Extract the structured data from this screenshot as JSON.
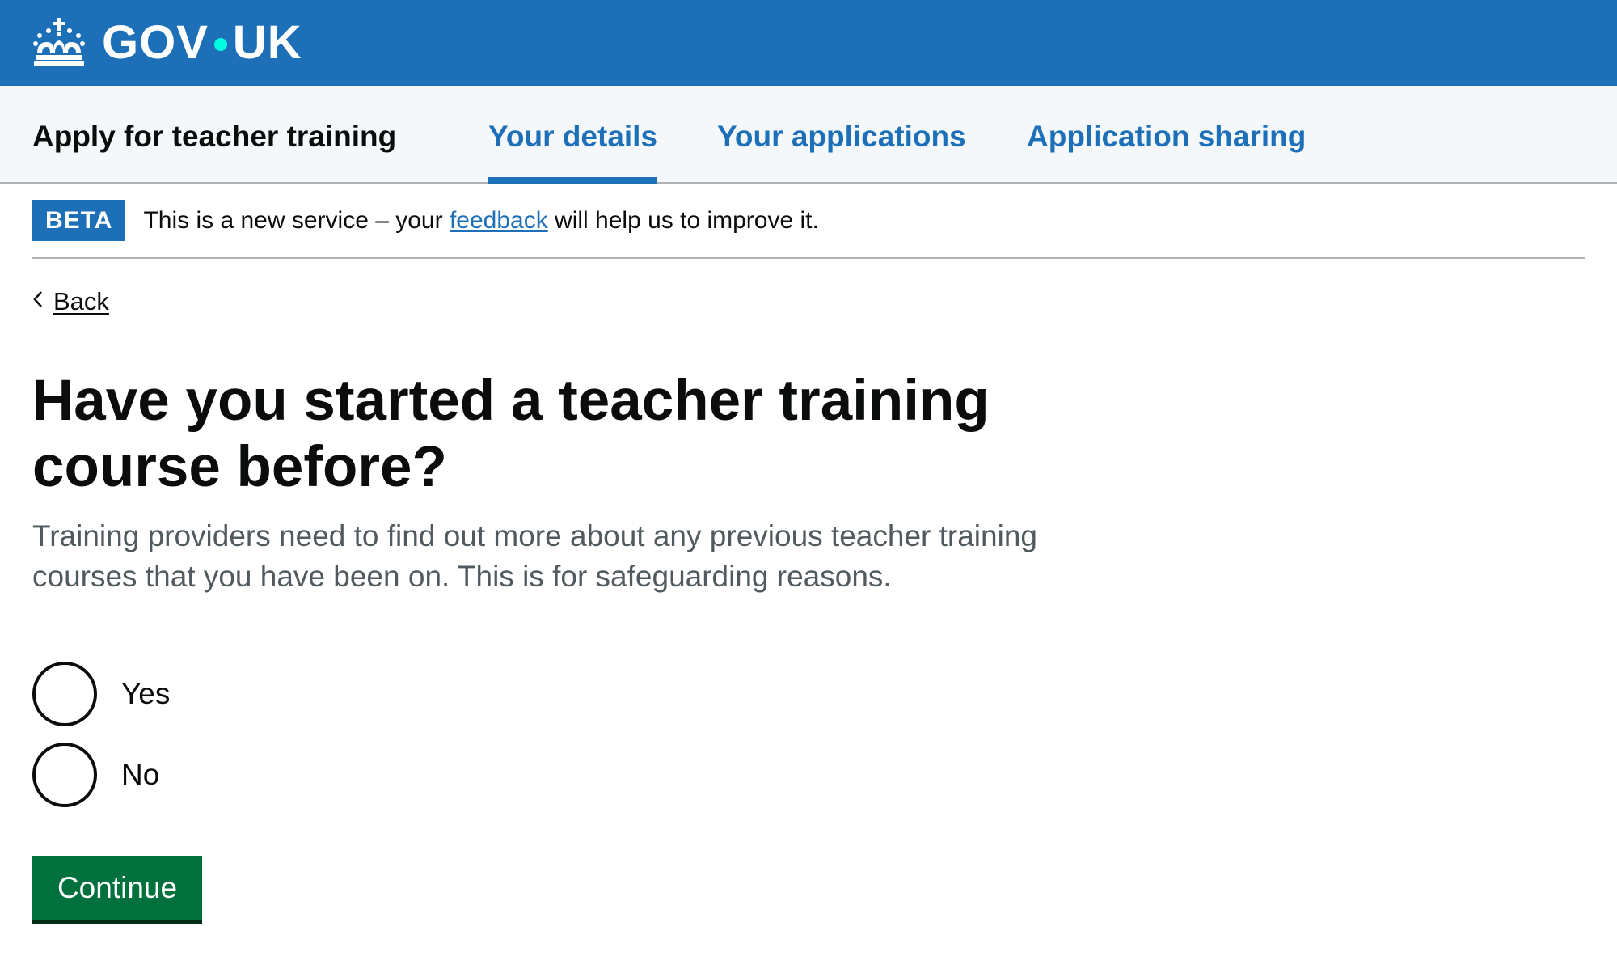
{
  "header": {
    "logo_left": "GOV",
    "logo_right": "UK",
    "crown_icon": "crown-icon"
  },
  "service_nav": {
    "service_name": "Apply for teacher training",
    "items": [
      {
        "label": "Your details",
        "active": true
      },
      {
        "label": "Your applications",
        "active": false
      },
      {
        "label": "Application sharing",
        "active": false
      }
    ]
  },
  "phase_banner": {
    "tag": "BETA",
    "text_before": "This is a new service – your ",
    "link_text": "feedback",
    "text_after": " will help us to improve it."
  },
  "back_link": {
    "label": "Back",
    "icon": "chevron-left-icon"
  },
  "question": {
    "title": "Have you started a teacher training course before?",
    "hint": "Training providers need to find out more about any previous teacher training courses that you have been on. This is for safeguarding reasons.",
    "options": [
      {
        "label": "Yes",
        "selected": false
      },
      {
        "label": "No",
        "selected": false
      }
    ]
  },
  "actions": {
    "continue_label": "Continue"
  },
  "colors": {
    "header_blue": "#1d70b8",
    "nav_background": "#f4f8fb",
    "link_blue": "#1d70b8",
    "button_green": "#00703c",
    "hint_grey": "#505a5f",
    "text": "#0b0c0c",
    "dot_accent": "#00ffe0"
  }
}
